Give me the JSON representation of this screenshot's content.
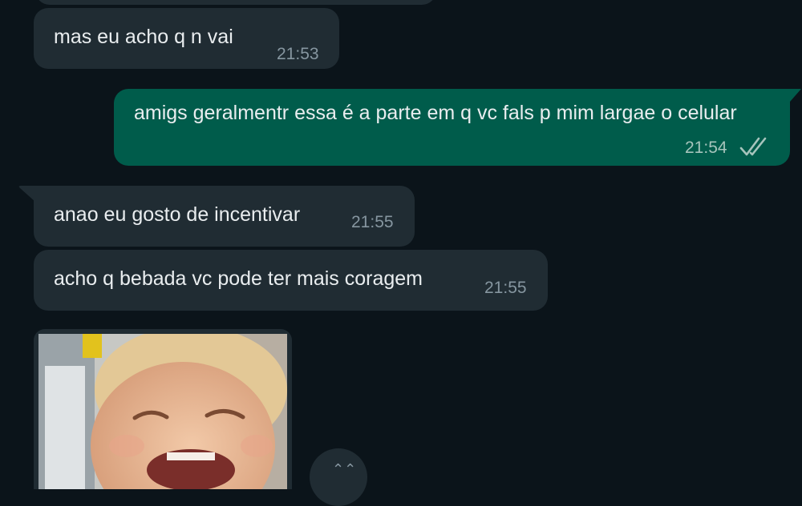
{
  "messages": [
    {
      "direction": "incoming",
      "text": "mas eu acho q n vai",
      "time": "21:53"
    },
    {
      "direction": "outgoing",
      "text": "amigs geralmentr essa é a parte em q vc fals p mim largae o celular",
      "time": "21:54",
      "status_icon": "double-check-icon"
    },
    {
      "direction": "incoming",
      "text": "anao eu gosto de incentivar",
      "time": "21:55"
    },
    {
      "direction": "incoming",
      "text": "acho q bebada vc pode ter mais coragem",
      "time": "21:55"
    },
    {
      "direction": "incoming",
      "type": "image",
      "image": "laughing-toddler-photo"
    }
  ],
  "colors": {
    "background": "#0b141a",
    "incoming_bubble": "#202c33",
    "outgoing_bubble": "#005c4b",
    "text": "#e9edef",
    "time": "#8696a0"
  }
}
